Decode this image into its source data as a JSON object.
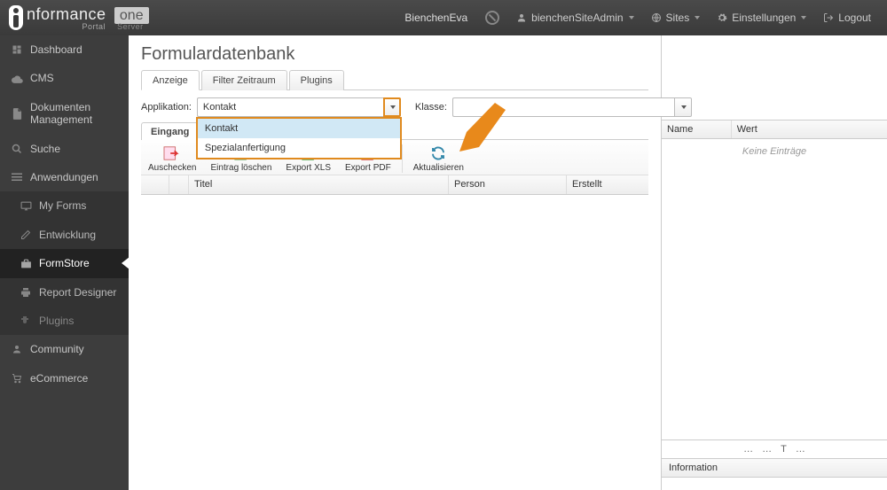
{
  "brand": {
    "text": "nformance",
    "one": "one",
    "sub_portal": "Portal",
    "sub_server": "Server"
  },
  "topbar": {
    "username": "BienchenEva",
    "admin_label": "bienchenSiteAdmin",
    "sites_label": "Sites",
    "settings_label": "Einstellungen",
    "logout_label": "Logout"
  },
  "sidebar": {
    "items": [
      {
        "icon": "dashboard",
        "label": "Dashboard"
      },
      {
        "icon": "cloud",
        "label": "CMS"
      },
      {
        "icon": "doc",
        "label": "Dokumenten Management"
      },
      {
        "icon": "search",
        "label": "Suche"
      },
      {
        "icon": "apps",
        "label": "Anwendungen"
      },
      {
        "icon": "screen",
        "label": "My Forms",
        "sub": true
      },
      {
        "icon": "edit",
        "label": "Entwicklung",
        "sub": true
      },
      {
        "icon": "box",
        "label": "FormStore",
        "sub": true,
        "active": true
      },
      {
        "icon": "print",
        "label": "Report Designer",
        "sub": true
      },
      {
        "icon": "plugin",
        "label": "Plugins",
        "sub": true
      },
      {
        "icon": "user",
        "label": "Community"
      },
      {
        "icon": "cart",
        "label": "eCommerce"
      }
    ]
  },
  "page": {
    "title": "Formulardatenbank",
    "tabs": [
      "Anzeige",
      "Filter Zeitraum",
      "Plugins"
    ],
    "active_tab": 0,
    "app_label": "Applikation:",
    "klasse_label": "Klasse:",
    "app_value": "Kontakt",
    "dropdown_options": [
      "Kontakt",
      "Spezialanfertigung"
    ],
    "subtab": "Eingang",
    "toolbar": [
      {
        "label": "Auschecken"
      },
      {
        "label": "Eintrag löschen"
      },
      {
        "label": "Export XLS"
      },
      {
        "label": "Export PDF"
      },
      {
        "label": "Aktualisieren"
      }
    ],
    "grid_columns": [
      "Titel",
      "Person",
      "Erstellt"
    ]
  },
  "rightpanel": {
    "columns": [
      "Name",
      "Wert"
    ],
    "empty_text": "Keine Einträge",
    "section_title": "Information"
  }
}
